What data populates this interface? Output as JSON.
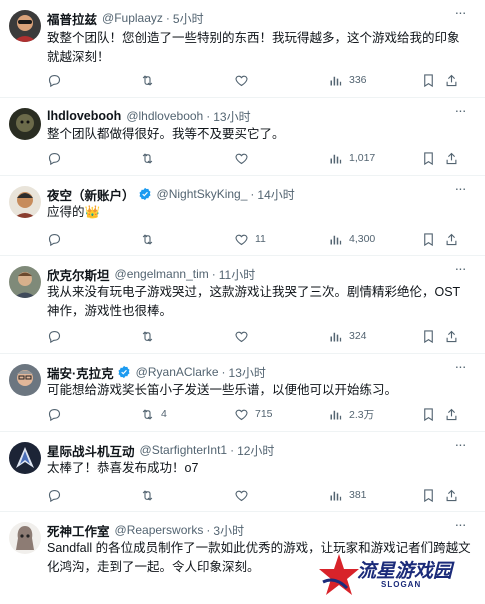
{
  "tweets": [
    {
      "name": "福普拉兹",
      "handle": "@Fuplaayz",
      "time": "5小时",
      "verified": false,
      "text": "致整个团队！您创造了一些特别的东西！我玩得越多，这个游戏给我的印象就越深刻！",
      "replies": "",
      "retweets": "",
      "likes": "",
      "views": "336"
    },
    {
      "name": "lhdlovebooh",
      "handle": "@lhdlovebooh",
      "time": "13小时",
      "verified": false,
      "text": "整个团队都做得很好。我等不及要买它了。",
      "replies": "",
      "retweets": "",
      "likes": "",
      "views": "1,017"
    },
    {
      "name": "夜空（新账户）",
      "handle": "@NightSkyKing_",
      "time": "14小时",
      "verified": true,
      "text": "应得的👑",
      "replies": "",
      "retweets": "",
      "likes": "11",
      "views": "4,300"
    },
    {
      "name": "欣克尔斯坦",
      "handle": "@engelmann_tim",
      "time": "11小时",
      "verified": false,
      "text": "我从来没有玩电子游戏哭过，这款游戏让我哭了三次。剧情精彩绝伦，OST 神作，游戏性也很棒。",
      "replies": "",
      "retweets": "",
      "likes": "",
      "views": "324"
    },
    {
      "name": "瑞安·克拉克",
      "handle": "@RyanAClarke",
      "time": "13小时",
      "verified": true,
      "text": "可能想给游戏奖长笛小子发送一些乐谱，以便他可以开始练习。",
      "replies": "",
      "retweets": "4",
      "likes": "715",
      "views": "2.3万"
    },
    {
      "name": "星际战斗机互动",
      "handle": "@StarfighterInt1",
      "time": "12小时",
      "verified": false,
      "text": "太棒了！恭喜发布成功！o7",
      "replies": "",
      "retweets": "",
      "likes": "",
      "views": "381"
    },
    {
      "name": "死神工作室",
      "handle": "@Reapersworks",
      "time": "3小时",
      "verified": false,
      "text": "Sandfall 的各位成员制作了一款如此优秀的游戏，让玩家和游戏记者们跨越文化鸿沟，走到了一起。令人印象深刻。",
      "replies": "",
      "retweets": "",
      "likes": "",
      "views": ""
    }
  ],
  "separator": "·",
  "watermark": {
    "text": "流星游戏园",
    "slogan": "SLOGAN"
  },
  "colors": {
    "text": "#0f1419",
    "secondary": "#536471",
    "verified": "#1d9bf0",
    "divider": "#eff3f4",
    "watermark": "#1b2b7a",
    "watermark_accent": "#d8232a"
  },
  "icons": [
    "reply-icon",
    "retweet-icon",
    "like-icon",
    "views-icon",
    "bookmark-icon",
    "share-icon",
    "more-icon",
    "verified-badge-icon"
  ]
}
